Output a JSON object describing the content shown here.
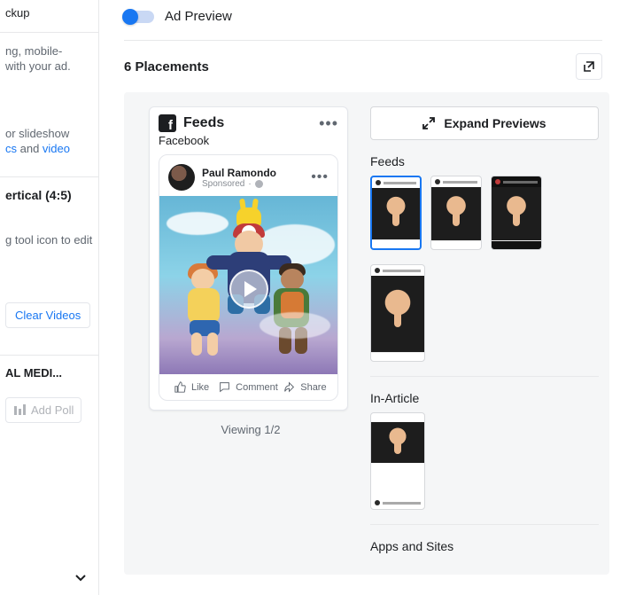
{
  "left": {
    "item0_tail": "ckup",
    "helper1": "ng, mobile-\nwith your ad.",
    "helper2_p1": "or slideshow ",
    "helper2_link1": "cs",
    "helper2_mid": " and ",
    "helper2_link2": "video",
    "ratio_heading": "ertical (4:5)",
    "edit_helper": "g tool icon to edit",
    "clear_videos": "Clear Videos",
    "media_heading": "AL MEDI...",
    "add_poll": "Add Poll"
  },
  "main": {
    "ad_preview_label": "Ad Preview",
    "placements_title": "6 Placements",
    "expand_label": "Expand Previews",
    "sections": {
      "feeds": "Feeds",
      "in_article": "In-Article",
      "apps_sites": "Apps and Sites"
    }
  },
  "phone": {
    "feeds_title": "Feeds",
    "platform": "Facebook",
    "poster": "Paul Ramondo",
    "sponsored": "Sponsored",
    "actions": {
      "like": "Like",
      "comment": "Comment",
      "share": "Share"
    },
    "viewing": "Viewing 1/2"
  }
}
